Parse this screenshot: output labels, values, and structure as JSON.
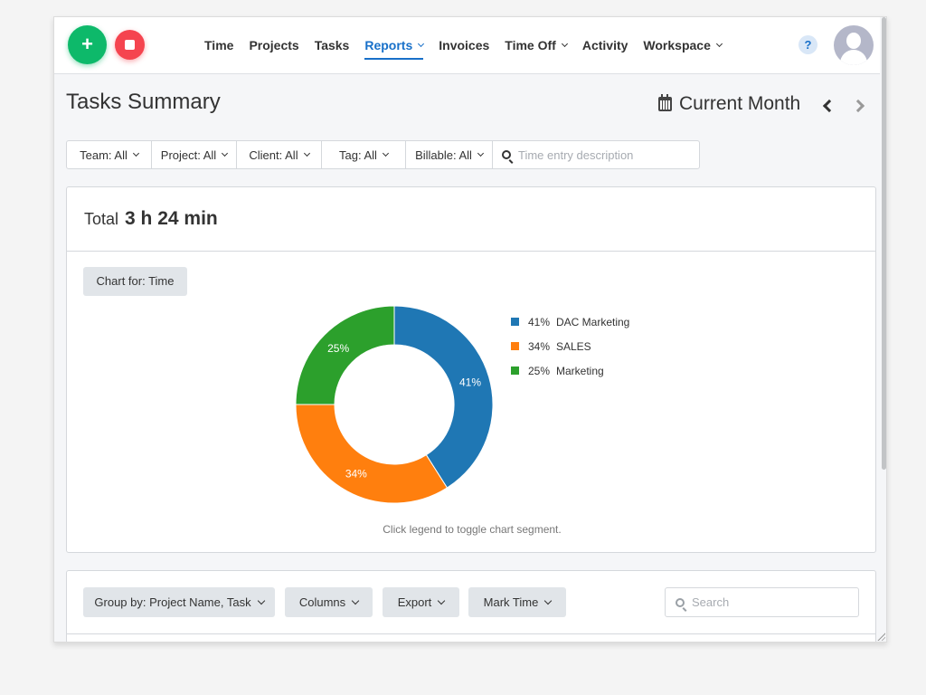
{
  "topbar": {
    "add_label": "+",
    "nav": [
      {
        "label": "Time",
        "dropdown": false,
        "active": false
      },
      {
        "label": "Projects",
        "dropdown": false,
        "active": false
      },
      {
        "label": "Tasks",
        "dropdown": false,
        "active": false
      },
      {
        "label": "Reports",
        "dropdown": true,
        "active": true
      },
      {
        "label": "Invoices",
        "dropdown": false,
        "active": false
      },
      {
        "label": "Time Off",
        "dropdown": true,
        "active": false
      },
      {
        "label": "Activity",
        "dropdown": false,
        "active": false
      },
      {
        "label": "Workspace",
        "dropdown": true,
        "active": false
      }
    ],
    "help_label": "?"
  },
  "header": {
    "title": "Tasks Summary",
    "date_range": "Current Month"
  },
  "filters": {
    "items": [
      "Team: All",
      "Project: All",
      "Client: All",
      "Tag: All",
      "Billable: All"
    ],
    "search_placeholder": "Time entry description"
  },
  "summary": {
    "total_label": "Total",
    "total_value": "3 h 24 min",
    "chart_for_label": "Chart for: Time",
    "hint": "Click legend to toggle chart segment."
  },
  "chart_data": {
    "type": "pie",
    "variant": "donut",
    "title": "",
    "slices": [
      {
        "label": "DAC Marketing",
        "value": 41,
        "display": "41%",
        "color": "#1f77b4"
      },
      {
        "label": "SALES",
        "value": 34,
        "display": "34%",
        "color": "#ff7f0e"
      },
      {
        "label": "Marketing",
        "value": 25,
        "display": "25%",
        "color": "#2ca02c"
      }
    ],
    "legend_position": "right",
    "start_angle": "12 o'clock, clockwise"
  },
  "table_toolbar": {
    "buttons": [
      "Group by: Project Name, Task",
      "Columns",
      "Export",
      "Mark Time"
    ],
    "search_placeholder": "Search"
  }
}
